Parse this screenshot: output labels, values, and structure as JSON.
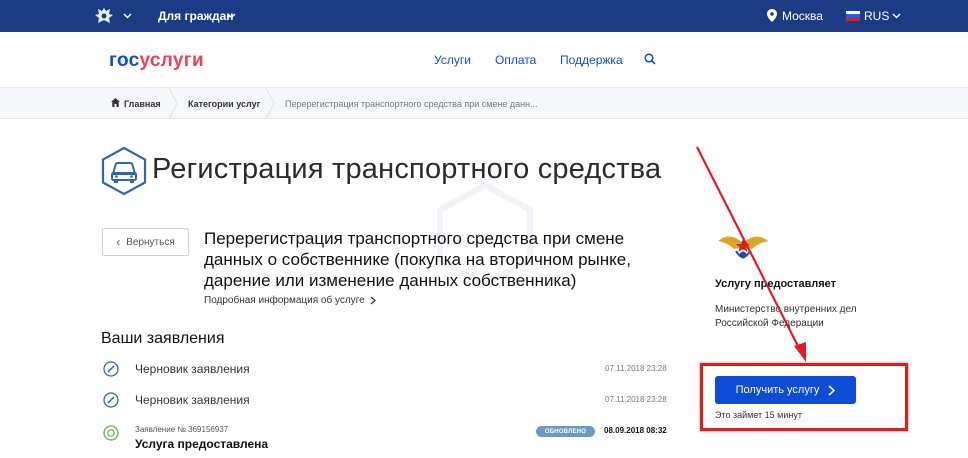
{
  "topbar": {
    "emblem_icon": "coat-of-arms-icon",
    "citizens_label": "Для граждан",
    "city": "Москва",
    "language": "RUS"
  },
  "header": {
    "logo_part1": "гос",
    "logo_part2": "услуги",
    "nav": [
      "Услуги",
      "Оплата",
      "Поддержка"
    ],
    "search_icon": "search-icon"
  },
  "breadcrumbs": [
    "Главная",
    "Категории услуг",
    "Перерегистрация транспортного средства при смене данн..."
  ],
  "page": {
    "title": "Регистрация транспортного средства",
    "back_label": "Вернуться",
    "service_title": "Перерегистрация транспортного средства при смене данных о собственнике (покупка на вторичном рынке, дарение или изменение данных собственника)",
    "more_info": "Подробная информация об услуге",
    "applications_heading": "Ваши заявления"
  },
  "applications": [
    {
      "label": "Черновик заявления",
      "date": "07.11.2018 23:28"
    },
    {
      "label": "Черновик заявления",
      "date": "07.11.2018 23:28"
    }
  ],
  "submitted": {
    "number": "Заявление № 369156937",
    "status": "Услуга предоставлена",
    "badge": "ОБНОВЛЕНО",
    "date": "08.09.2018 08:32"
  },
  "provider": {
    "heading": "Услугу предоставляет",
    "name": "Министерство внутренних дел Российской Федерации",
    "button": "Получить услугу",
    "duration": "Это займет 15 минут"
  },
  "colors": {
    "topbar": "#1c3b85",
    "accent": "#0d4cd3",
    "logo_red": "#ee3f58",
    "highlight": "#e11b22"
  }
}
